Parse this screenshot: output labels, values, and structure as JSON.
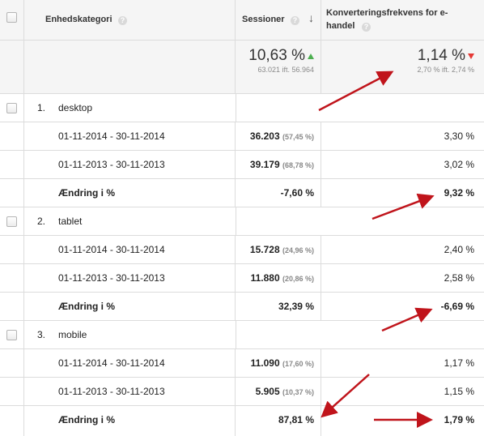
{
  "header": {
    "col_category": "Enhedskategori",
    "col_sessions": "Sessioner",
    "col_conversion_line1": "Konverteringsfrekvens for e-",
    "col_conversion_line2": "handel",
    "help_glyph": "?",
    "sort_glyph": "↓"
  },
  "totals": {
    "sessions_value": "10,63 %",
    "sessions_compare": "63.021 ift. 56.964",
    "conversion_value": "1,14 %",
    "conversion_compare": "2,70 % ift. 2,74 %",
    "sessions_trend": "up",
    "conversion_trend": "down"
  },
  "groups": [
    {
      "index": "1.",
      "name": "desktop",
      "rows": [
        {
          "label": "01-11-2014 - 30-11-2014",
          "sessions": "36.203",
          "sessions_pct": "(57,45 %)",
          "conversion": "3,30 %"
        },
        {
          "label": "01-11-2013 - 30-11-2013",
          "sessions": "39.179",
          "sessions_pct": "(68,78 %)",
          "conversion": "3,02 %"
        }
      ],
      "change": {
        "label": "Ændring i %",
        "sessions": "-7,60 %",
        "conversion": "9,32 %"
      }
    },
    {
      "index": "2.",
      "name": "tablet",
      "rows": [
        {
          "label": "01-11-2014 - 30-11-2014",
          "sessions": "15.728",
          "sessions_pct": "(24,96 %)",
          "conversion": "2,40 %"
        },
        {
          "label": "01-11-2013 - 30-11-2013",
          "sessions": "11.880",
          "sessions_pct": "(20,86 %)",
          "conversion": "2,58 %"
        }
      ],
      "change": {
        "label": "Ændring i %",
        "sessions": "32,39 %",
        "conversion": "-6,69 %"
      }
    },
    {
      "index": "3.",
      "name": "mobile",
      "rows": [
        {
          "label": "01-11-2014 - 30-11-2014",
          "sessions": "11.090",
          "sessions_pct": "(17,60 %)",
          "conversion": "1,17 %"
        },
        {
          "label": "01-11-2013 - 30-11-2013",
          "sessions": "5.905",
          "sessions_pct": "(10,37 %)",
          "conversion": "1,15 %"
        }
      ],
      "change": {
        "label": "Ændring i %",
        "sessions": "87,81 %",
        "conversion": "1,79 %"
      }
    }
  ],
  "colors": {
    "accent_arrow": "#c0141b",
    "trend_up": "#4caf50",
    "trend_down": "#e53935",
    "header_bg": "#f5f5f5",
    "border": "#dcdcdc"
  }
}
